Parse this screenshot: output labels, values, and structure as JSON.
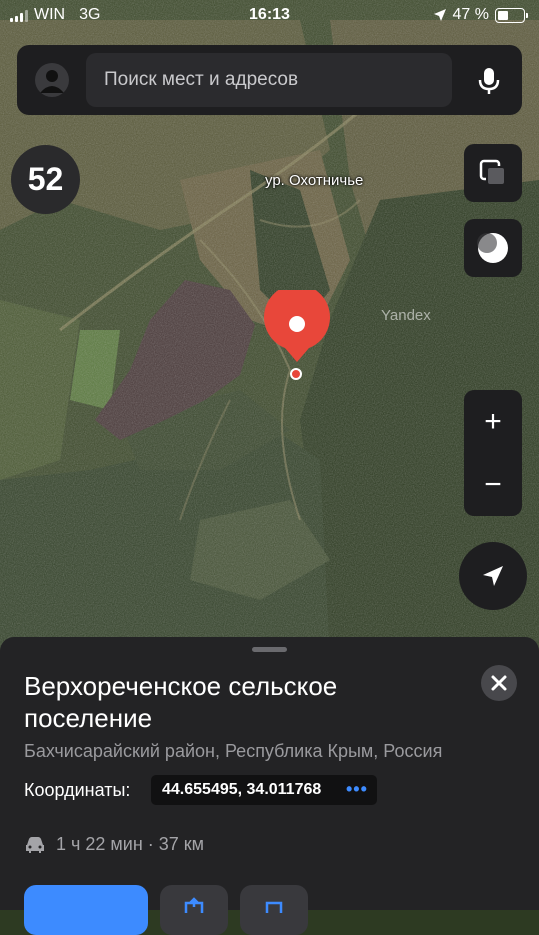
{
  "status_bar": {
    "carrier": "WIN",
    "network": "3G",
    "time": "16:13",
    "battery_percent": "47 %",
    "battery_level": 0.47
  },
  "search": {
    "placeholder": "Поиск мест и адресов"
  },
  "map": {
    "place_label": "ур. Охотничье",
    "provider_mark": "Yandex",
    "speed_limit": "52",
    "zoom_in": "+",
    "zoom_out": "−"
  },
  "icons": {
    "profile": "person-icon",
    "voice": "microphone-icon",
    "layers": "layers-icon",
    "night_mode": "night-mode-icon",
    "locate": "navigation-arrow-icon",
    "close": "close-icon",
    "car": "car-icon"
  },
  "place_card": {
    "title": "Верхореченское сельское поселение",
    "subtitle": "Бахчисарайский район, Республика Крым, Россия",
    "coordinates_label": "Координаты:",
    "coordinates_value": "44.655495, 34.011768",
    "coordinates_more": "•••",
    "route_info": "1 ч 22 мин · 37 км"
  },
  "colors": {
    "accent": "#3d8bff",
    "pin": "#e8473a",
    "panel": "#1e1e20"
  }
}
